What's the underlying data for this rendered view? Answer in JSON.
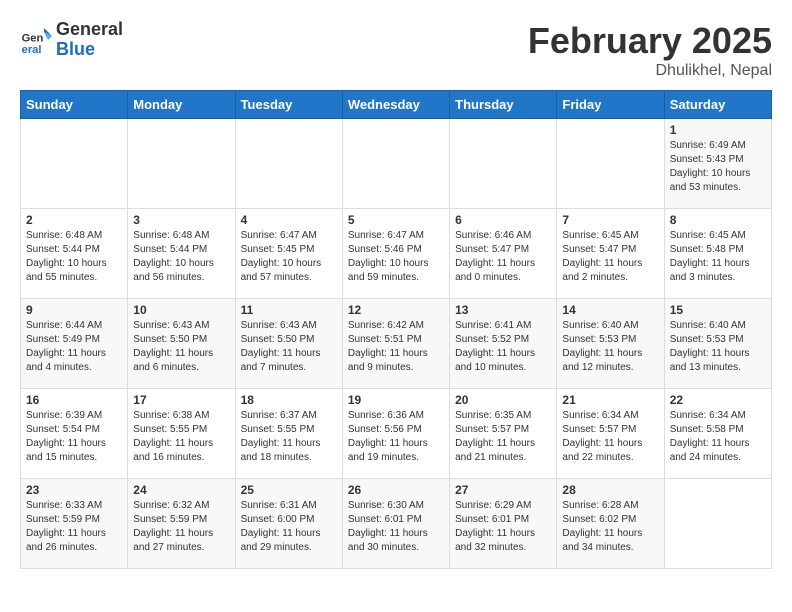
{
  "header": {
    "logo_general": "General",
    "logo_blue": "Blue",
    "title": "February 2025",
    "subtitle": "Dhulikhel, Nepal"
  },
  "days_of_week": [
    "Sunday",
    "Monday",
    "Tuesday",
    "Wednesday",
    "Thursday",
    "Friday",
    "Saturday"
  ],
  "weeks": [
    [
      {
        "day": "",
        "info": ""
      },
      {
        "day": "",
        "info": ""
      },
      {
        "day": "",
        "info": ""
      },
      {
        "day": "",
        "info": ""
      },
      {
        "day": "",
        "info": ""
      },
      {
        "day": "",
        "info": ""
      },
      {
        "day": "1",
        "info": "Sunrise: 6:49 AM\nSunset: 5:43 PM\nDaylight: 10 hours and 53 minutes."
      }
    ],
    [
      {
        "day": "2",
        "info": "Sunrise: 6:48 AM\nSunset: 5:44 PM\nDaylight: 10 hours and 55 minutes."
      },
      {
        "day": "3",
        "info": "Sunrise: 6:48 AM\nSunset: 5:44 PM\nDaylight: 10 hours and 56 minutes."
      },
      {
        "day": "4",
        "info": "Sunrise: 6:47 AM\nSunset: 5:45 PM\nDaylight: 10 hours and 57 minutes."
      },
      {
        "day": "5",
        "info": "Sunrise: 6:47 AM\nSunset: 5:46 PM\nDaylight: 10 hours and 59 minutes."
      },
      {
        "day": "6",
        "info": "Sunrise: 6:46 AM\nSunset: 5:47 PM\nDaylight: 11 hours and 0 minutes."
      },
      {
        "day": "7",
        "info": "Sunrise: 6:45 AM\nSunset: 5:47 PM\nDaylight: 11 hours and 2 minutes."
      },
      {
        "day": "8",
        "info": "Sunrise: 6:45 AM\nSunset: 5:48 PM\nDaylight: 11 hours and 3 minutes."
      }
    ],
    [
      {
        "day": "9",
        "info": "Sunrise: 6:44 AM\nSunset: 5:49 PM\nDaylight: 11 hours and 4 minutes."
      },
      {
        "day": "10",
        "info": "Sunrise: 6:43 AM\nSunset: 5:50 PM\nDaylight: 11 hours and 6 minutes."
      },
      {
        "day": "11",
        "info": "Sunrise: 6:43 AM\nSunset: 5:50 PM\nDaylight: 11 hours and 7 minutes."
      },
      {
        "day": "12",
        "info": "Sunrise: 6:42 AM\nSunset: 5:51 PM\nDaylight: 11 hours and 9 minutes."
      },
      {
        "day": "13",
        "info": "Sunrise: 6:41 AM\nSunset: 5:52 PM\nDaylight: 11 hours and 10 minutes."
      },
      {
        "day": "14",
        "info": "Sunrise: 6:40 AM\nSunset: 5:53 PM\nDaylight: 11 hours and 12 minutes."
      },
      {
        "day": "15",
        "info": "Sunrise: 6:40 AM\nSunset: 5:53 PM\nDaylight: 11 hours and 13 minutes."
      }
    ],
    [
      {
        "day": "16",
        "info": "Sunrise: 6:39 AM\nSunset: 5:54 PM\nDaylight: 11 hours and 15 minutes."
      },
      {
        "day": "17",
        "info": "Sunrise: 6:38 AM\nSunset: 5:55 PM\nDaylight: 11 hours and 16 minutes."
      },
      {
        "day": "18",
        "info": "Sunrise: 6:37 AM\nSunset: 5:55 PM\nDaylight: 11 hours and 18 minutes."
      },
      {
        "day": "19",
        "info": "Sunrise: 6:36 AM\nSunset: 5:56 PM\nDaylight: 11 hours and 19 minutes."
      },
      {
        "day": "20",
        "info": "Sunrise: 6:35 AM\nSunset: 5:57 PM\nDaylight: 11 hours and 21 minutes."
      },
      {
        "day": "21",
        "info": "Sunrise: 6:34 AM\nSunset: 5:57 PM\nDaylight: 11 hours and 22 minutes."
      },
      {
        "day": "22",
        "info": "Sunrise: 6:34 AM\nSunset: 5:58 PM\nDaylight: 11 hours and 24 minutes."
      }
    ],
    [
      {
        "day": "23",
        "info": "Sunrise: 6:33 AM\nSunset: 5:59 PM\nDaylight: 11 hours and 26 minutes."
      },
      {
        "day": "24",
        "info": "Sunrise: 6:32 AM\nSunset: 5:59 PM\nDaylight: 11 hours and 27 minutes."
      },
      {
        "day": "25",
        "info": "Sunrise: 6:31 AM\nSunset: 6:00 PM\nDaylight: 11 hours and 29 minutes."
      },
      {
        "day": "26",
        "info": "Sunrise: 6:30 AM\nSunset: 6:01 PM\nDaylight: 11 hours and 30 minutes."
      },
      {
        "day": "27",
        "info": "Sunrise: 6:29 AM\nSunset: 6:01 PM\nDaylight: 11 hours and 32 minutes."
      },
      {
        "day": "28",
        "info": "Sunrise: 6:28 AM\nSunset: 6:02 PM\nDaylight: 11 hours and 34 minutes."
      },
      {
        "day": "",
        "info": ""
      }
    ]
  ]
}
